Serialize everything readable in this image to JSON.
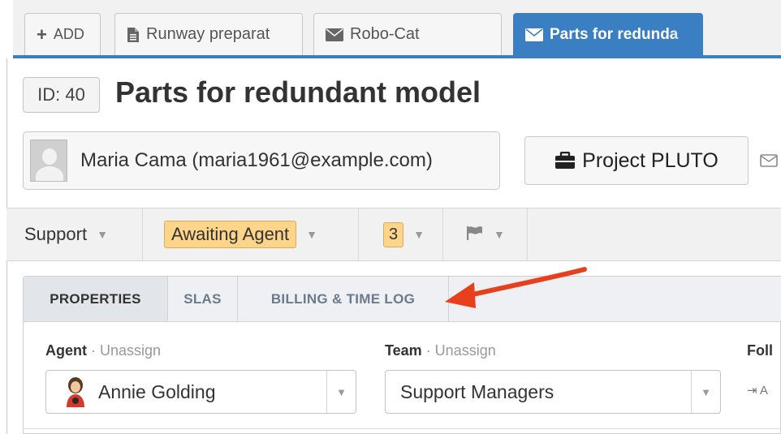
{
  "tabs": {
    "add_label": "ADD",
    "items": [
      {
        "label": "Runway preparat",
        "icon": "document-icon"
      },
      {
        "label": "Robo-Cat",
        "icon": "envelope-icon"
      },
      {
        "label": "Parts for redunda",
        "icon": "envelope-icon",
        "active": true
      }
    ]
  },
  "ticket": {
    "id_label": "ID: 40",
    "title": "Parts for redundant model",
    "person": "Maria Cama (maria1961@example.com)",
    "project": "Project PLUTO"
  },
  "statusbar": {
    "department": "Support",
    "status": "Awaiting Agent",
    "priority": "3",
    "flag_icon": "flag-icon"
  },
  "panel": {
    "tabs": [
      "PROPERTIES",
      "SLAS",
      "BILLING & TIME LOG"
    ],
    "active_tab": "PROPERTIES",
    "agent_label": "Agent",
    "agent_unassign": " · Unassign",
    "agent_value": "Annie Golding",
    "team_label": "Team",
    "team_unassign": " · Unassign",
    "team_value": "Support Managers",
    "followers_label": "Foll",
    "followers_add": "A"
  },
  "colors": {
    "accent": "#3a7fc1",
    "status_pill": "#fcd48a",
    "annotation_arrow": "#e8401c"
  }
}
